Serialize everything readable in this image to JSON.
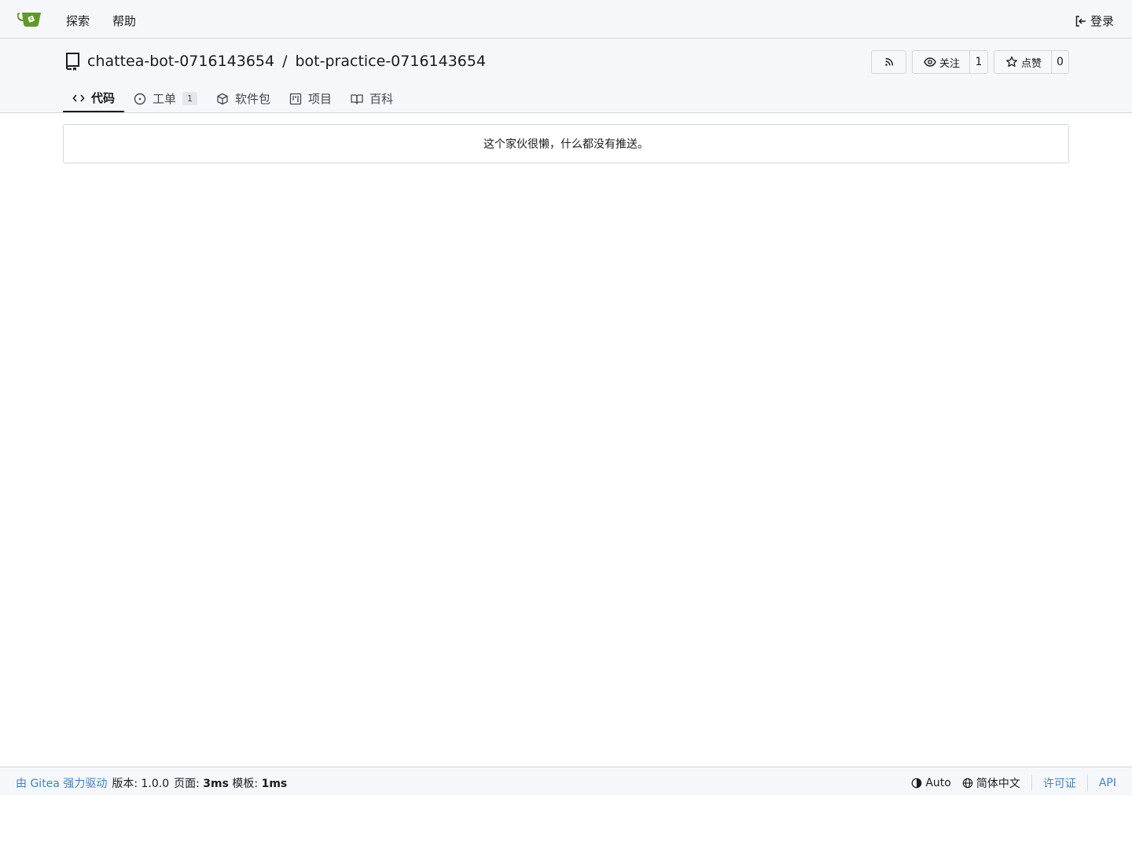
{
  "navbar": {
    "explore": "探索",
    "help": "帮助",
    "login": "登录"
  },
  "repo": {
    "owner": "chattea-bot-0716143654",
    "separator": "/",
    "name": "bot-practice-0716143654",
    "watch_label": "关注",
    "watch_count": "1",
    "star_label": "点赞",
    "star_count": "0"
  },
  "tabs": [
    {
      "label": "代码",
      "active": true
    },
    {
      "label": "工单",
      "badge": "1"
    },
    {
      "label": "软件包"
    },
    {
      "label": "项目"
    },
    {
      "label": "百科"
    }
  ],
  "main": {
    "empty_message": "这个家伙很懒，什么都没有推送。"
  },
  "footer": {
    "powered_by": "由 Gitea 强力驱动",
    "version_label": "版本:",
    "version": "1.0.0",
    "page_label": "页面:",
    "page_time": "3ms",
    "template_label": "模板:",
    "template_time": "1ms",
    "theme": "Auto",
    "language": "简体中文",
    "license": "许可证",
    "api": "API"
  },
  "colors": {
    "logo_green": "#609926",
    "link_blue": "#4183c4",
    "header_bg": "#f6f7fa",
    "border": "#d0d7de"
  }
}
